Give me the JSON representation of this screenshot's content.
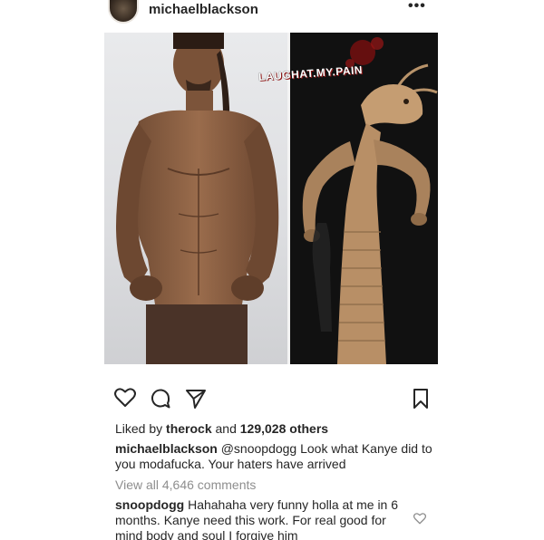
{
  "post": {
    "username": "michaelblackson",
    "more_label": "•••",
    "watermark": "LAUGHAT.MY.PAIN",
    "likes_prefix": "Liked by ",
    "likes_user": "therock",
    "likes_suffix": " and ",
    "likes_count": "129,028 others",
    "caption_user": "michaelblackson",
    "caption_text": " @snoopdogg Look what Kanye did to you modafucka. Your haters have arrived",
    "view_all": "View all 4,646 comments",
    "comment_user": "snoopdogg",
    "comment_text": " Hahahaha very funny holla at me in 6 months.  Kanye need this work. For real good for mind body and soul I forgive him"
  },
  "icons": {
    "like": "heart-icon",
    "comment": "comment-icon",
    "share": "share-icon",
    "save": "bookmark-icon",
    "comment_like": "heart-icon"
  }
}
